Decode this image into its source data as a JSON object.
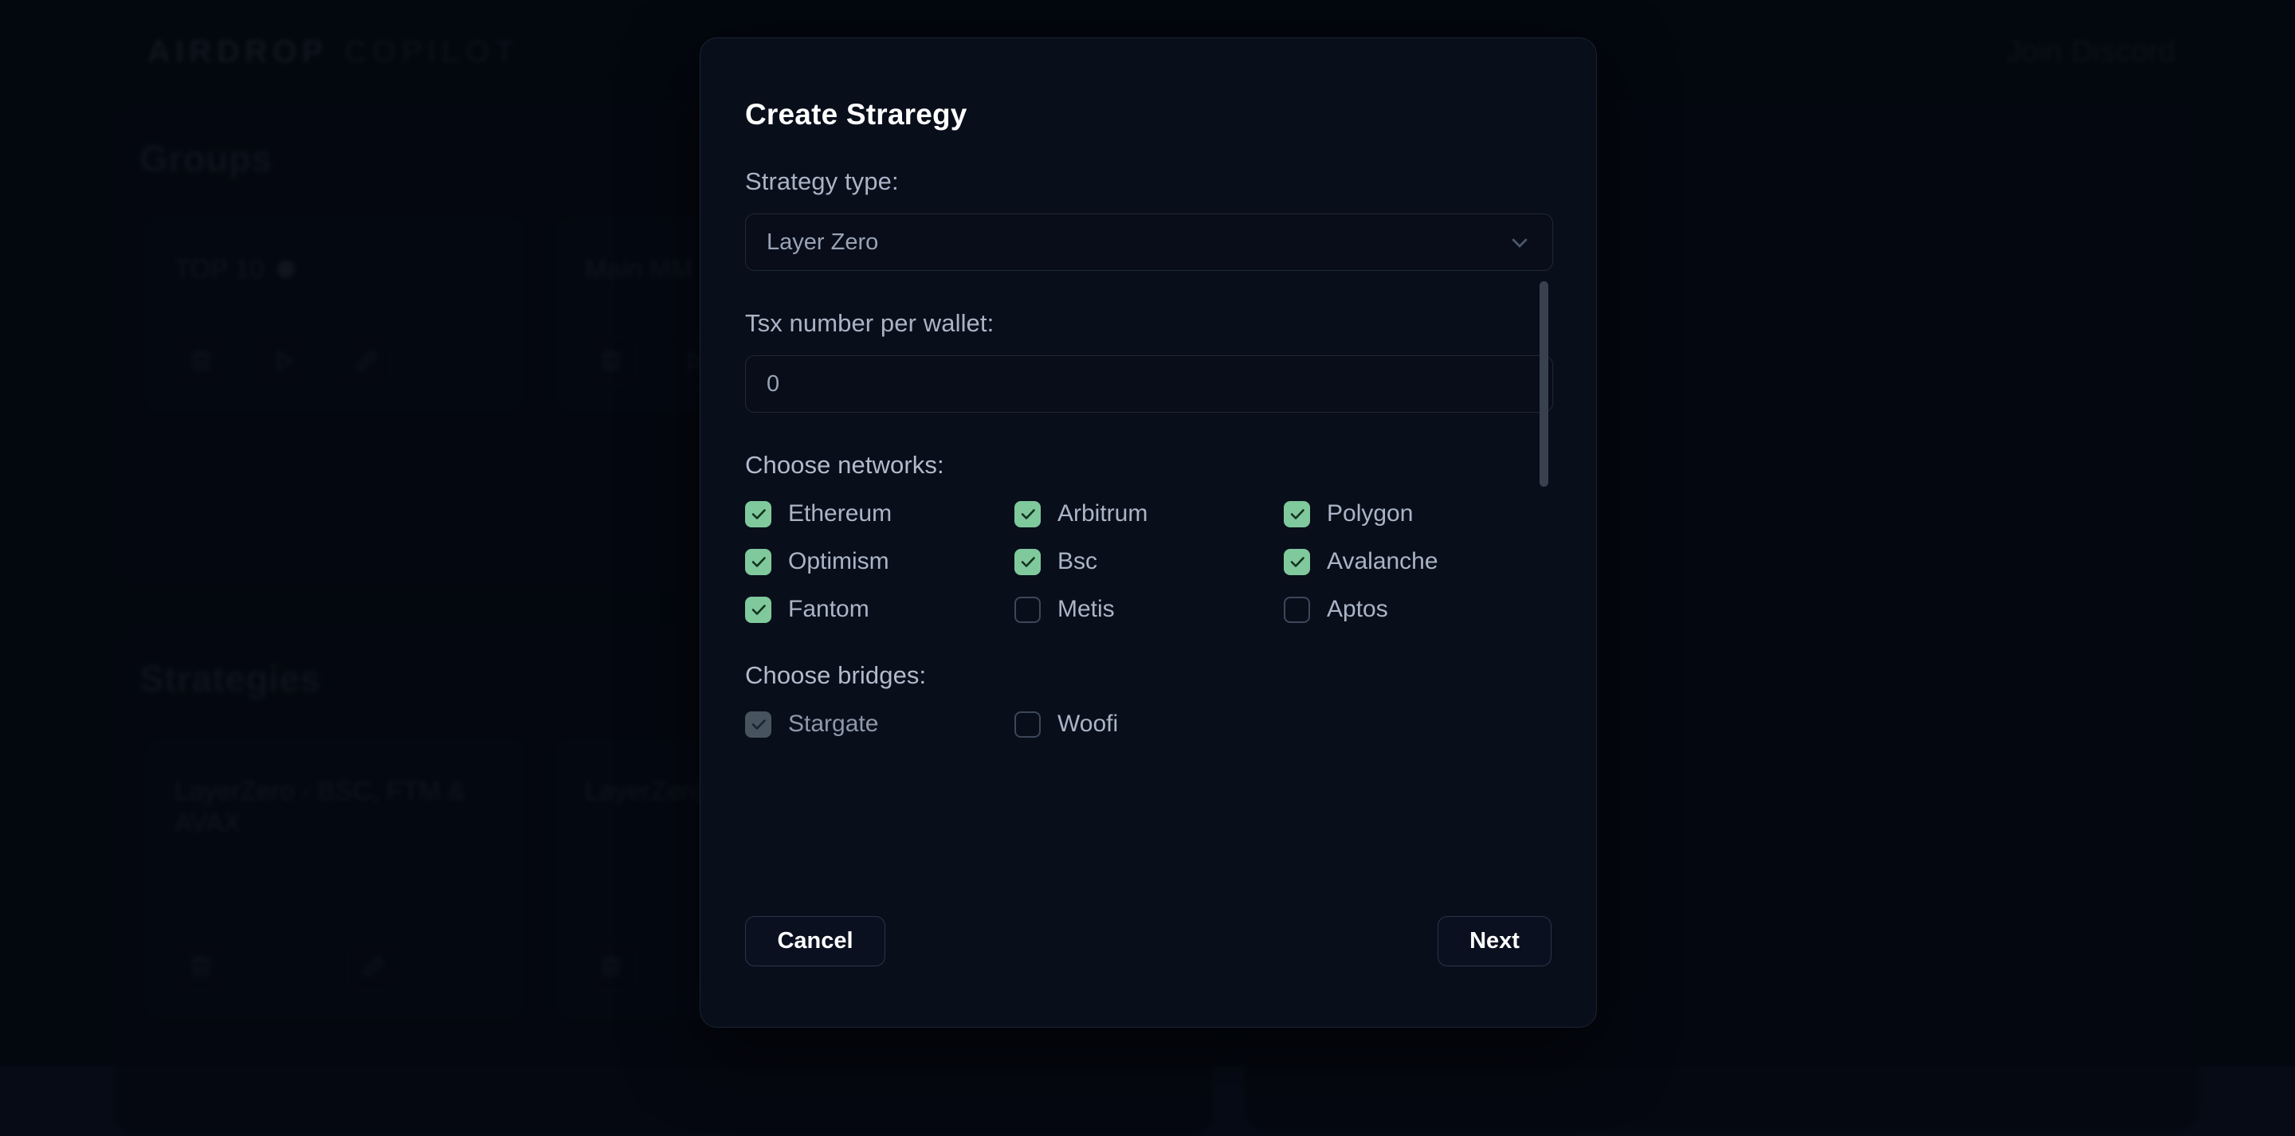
{
  "app": {
    "brand_primary": "AIRDROP",
    "brand_secondary": "COPILOT",
    "discord_link": "Join Discord"
  },
  "background": {
    "groups_section_title": "Groups",
    "strategies_section_title": "Strategies",
    "group_cards": [
      {
        "title": "TOP 10",
        "has_badge_dot": true
      },
      {
        "title": "Main MM",
        "has_badge_dot": false
      },
      {
        "title": "",
        "has_badge_dot": false
      }
    ],
    "strategy_cards": [
      {
        "title": "LayerZero - BSC, FTM & AVAX"
      },
      {
        "title": "LayerZero - POLYGON"
      },
      {
        "title": ""
      }
    ]
  },
  "modal": {
    "title": "Create Straregy",
    "strategy_type": {
      "label": "Strategy type:",
      "value": "Layer Zero",
      "chevron_icon": "chevron-down-icon"
    },
    "tsx_number": {
      "label": "Tsx number per wallet:",
      "value": "0",
      "placeholder": "0"
    },
    "networks": {
      "heading": "Choose networks:",
      "items": [
        {
          "label": "Ethereum",
          "checked": true,
          "disabled": false
        },
        {
          "label": "Arbitrum",
          "checked": true,
          "disabled": false
        },
        {
          "label": "Polygon",
          "checked": true,
          "disabled": false
        },
        {
          "label": "Optimism",
          "checked": true,
          "disabled": false
        },
        {
          "label": "Bsc",
          "checked": true,
          "disabled": false
        },
        {
          "label": "Avalanche",
          "checked": true,
          "disabled": false
        },
        {
          "label": "Fantom",
          "checked": true,
          "disabled": false
        },
        {
          "label": "Metis",
          "checked": false,
          "disabled": false
        },
        {
          "label": "Aptos",
          "checked": false,
          "disabled": false
        }
      ]
    },
    "bridges": {
      "heading": "Choose bridges:",
      "items": [
        {
          "label": "Stargate",
          "checked": true,
          "disabled": true
        },
        {
          "label": "Woofi",
          "checked": false,
          "disabled": false
        }
      ]
    },
    "footer": {
      "cancel_label": "Cancel",
      "next_label": "Next"
    },
    "scrollbar": {
      "visible": true,
      "thumb_position": "top"
    }
  },
  "colors": {
    "page_background": "#070b16",
    "modal_background": "#090e1b",
    "checkbox_checked": "#7fc99c",
    "checkbox_disabled": "#47535f",
    "checkbox_border": "#3c4759",
    "text_primary": "#ffffff",
    "text_secondary": "#aab5c6",
    "scrollbar_thumb": "#39414f"
  }
}
